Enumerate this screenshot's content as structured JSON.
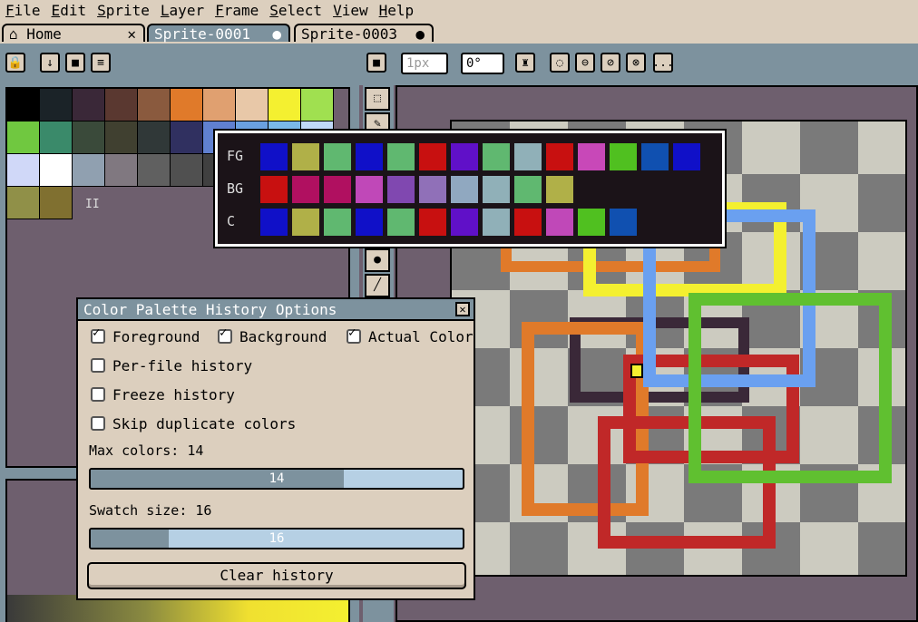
{
  "menu": [
    {
      "label": "File",
      "ul": "F",
      "rest": "ile"
    },
    {
      "label": "Edit",
      "ul": "E",
      "rest": "dit"
    },
    {
      "label": "Sprite",
      "ul": "S",
      "rest": "prite"
    },
    {
      "label": "Layer",
      "ul": "L",
      "rest": "ayer"
    },
    {
      "label": "Frame",
      "ul": "F",
      "rest": "rame"
    },
    {
      "label": "Select",
      "ul": "S",
      "rest": "elect"
    },
    {
      "label": "View",
      "ul": "V",
      "rest": "iew"
    },
    {
      "label": "Help",
      "ul": "H",
      "rest": "elp"
    }
  ],
  "tabs": [
    {
      "label": "Home",
      "icon": "home-icon",
      "mark": "✕"
    },
    {
      "label": "Sprite-0001",
      "mark": "●"
    },
    {
      "label": "Sprite-0003",
      "mark": "●"
    }
  ],
  "toolbar": {
    "brush_size": "1px",
    "brush_angle": "0°",
    "buttons_left": [
      "lock-icon",
      "arrow-down-icon",
      "square-icon",
      "menu-icon"
    ],
    "buttons_right": [
      "lasso-icon",
      "pressure-icon",
      "slash-icon",
      "no-symbol-icon"
    ],
    "more": "..."
  },
  "palette": {
    "rows": [
      [
        "#000000",
        "#1b2328",
        "#3a2838",
        "#5a3830",
        "#8a5a3e",
        "#e07a2a",
        "#e0a070",
        "#e8c8a8",
        "#f4f030",
        "#a0e050"
      ],
      [
        "#70c840",
        "#3a8a6a",
        "#3a4a3a",
        "#404030",
        "#303838",
        "#303060",
        "#6080d0",
        "#6aa0e0",
        "#7ab8e8",
        "#c0d8f8"
      ],
      [
        "#d0d8f8",
        "#ffffff",
        "#90a0b0",
        "#807880",
        "#606060",
        "#505050",
        "#404040",
        "#303030",
        "#282830",
        "#202020"
      ],
      [
        "#909048",
        "#807030"
      ]
    ],
    "marker": "II"
  },
  "history": {
    "labels": [
      "FG",
      "BG",
      "C"
    ],
    "fg": [
      "#1010c8",
      "#b0b048",
      "#60b870",
      "#1010c8",
      "#60b870",
      "#c81010",
      "#6010c8",
      "#60b870",
      "#90b0b8",
      "#c81010",
      "#c848b8",
      "#50c020",
      "#1050b0",
      "#1010c8"
    ],
    "bg": [
      "#c81010",
      "#b01060",
      "#b01060",
      "#c048b8",
      "#8048b0",
      "#9070b8",
      "#90a8c0",
      "#90b0b8",
      "#60b870",
      "#b0b048"
    ],
    "c": [
      "#1010c8",
      "#b0b048",
      "#60b870",
      "#1010c8",
      "#60b870",
      "#c81010",
      "#6010c8",
      "#90b0b8",
      "#c81010",
      "#c048b8",
      "#50c020",
      "#1050b0"
    ]
  },
  "options": {
    "title": "Color Palette History Options",
    "foreground": "Foreground",
    "background": "Background",
    "actual": "Actual Color",
    "per_file": "Per-file history",
    "freeze": "Freeze history",
    "skip": "Skip duplicate colors",
    "max_label": "Max colors: 14",
    "max_value": "14",
    "max_fraction": 0.68,
    "swatch_label": "Swatch size: 16",
    "swatch_value": "16",
    "swatch_fraction": 0.21,
    "clear": "Clear history",
    "checked": {
      "foreground": true,
      "background": true,
      "actual": true,
      "per_file": false,
      "freeze": false,
      "skip": false
    }
  },
  "colors": {
    "ui_bg": "#dccfbe",
    "ui_blue": "#7d929e",
    "canvas_bg": "#6e5f6e",
    "checker_light": "#cccbc0",
    "checker_dark": "#7a7a7a"
  }
}
